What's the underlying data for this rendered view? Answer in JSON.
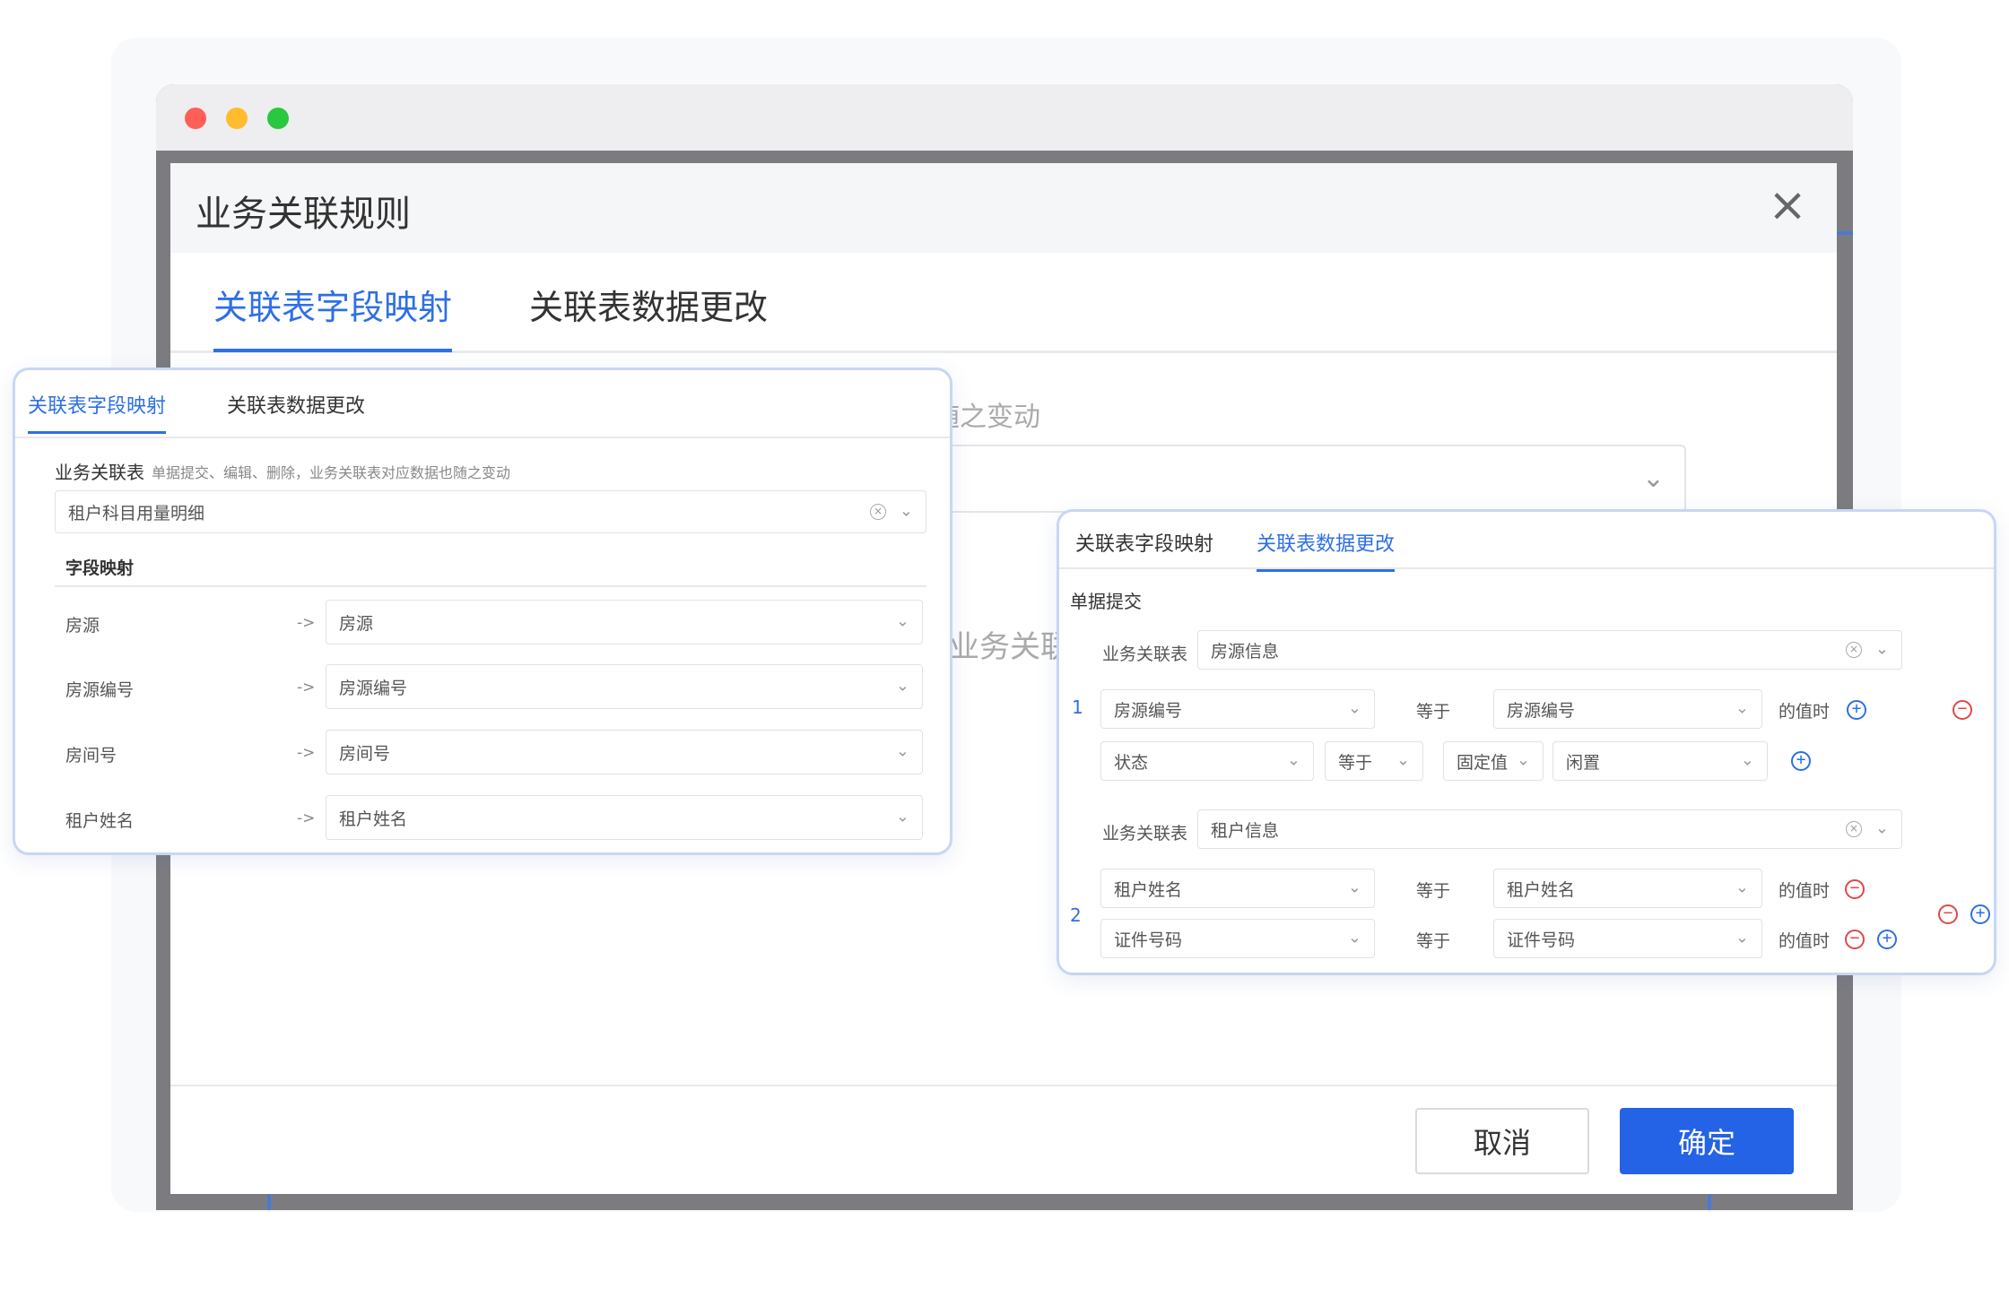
{
  "modal": {
    "title": "业务关联规则",
    "close": "×",
    "tabs": [
      "关联表字段映射",
      "关联表数据更改"
    ],
    "ghost_hint": "随之变动",
    "ghost_label": "业务关联",
    "chevron": "⌄",
    "cancel": "取消",
    "ok": "确定"
  },
  "left_panel": {
    "tabs": [
      "关联表字段映射",
      "关联表数据更改"
    ],
    "table_label": "业务关联表",
    "table_hint": "单据提交、编辑、删除，业务关联表对应数据也随之变动",
    "table_value": "租户科目用量明细",
    "section": "字段映射",
    "arrow": "->",
    "mappings": [
      {
        "source": "房源",
        "target": "房源"
      },
      {
        "source": "房源编号",
        "target": "房源编号"
      },
      {
        "source": "房间号",
        "target": "房间号"
      },
      {
        "source": "租户姓名",
        "target": "租户姓名"
      }
    ]
  },
  "right_panel": {
    "tabs": [
      "关联表字段映射",
      "关联表数据更改"
    ],
    "section": "单据提交",
    "table_label": "业务关联表",
    "equals": "等于",
    "when_value": "的值时",
    "groups": [
      {
        "num": "1",
        "table": "房源信息",
        "cond": {
          "field": "房源编号",
          "target": "房源编号"
        },
        "update": {
          "field": "状态",
          "op": "等于",
          "type": "固定值",
          "value": "闲置"
        }
      },
      {
        "num": "2",
        "table": "租户信息",
        "conds": [
          {
            "field": "租户姓名",
            "target": "租户姓名"
          },
          {
            "field": "证件号码",
            "target": "证件号码"
          }
        ]
      }
    ]
  },
  "icons": {
    "add": "+",
    "remove": "−",
    "clear": "×",
    "chevron": "⌄"
  },
  "colors": {
    "accent": "#2e6fe6",
    "primary_button": "#2462e6",
    "danger": "#e04848",
    "panel_border": "#c8d6f4"
  }
}
